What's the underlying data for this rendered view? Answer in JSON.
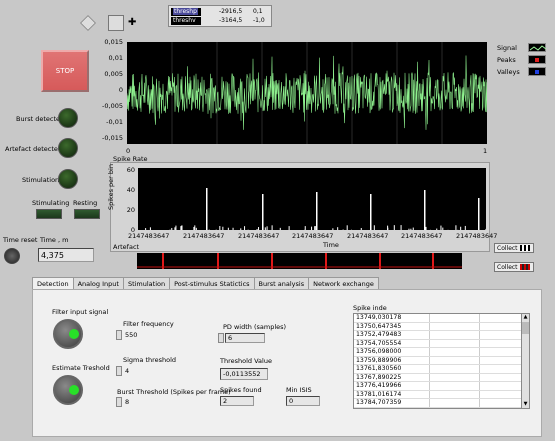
{
  "legend_top": {
    "rows": [
      {
        "name": "threshp",
        "v1": "-2916,5",
        "v2": "0,1"
      },
      {
        "name": "threshv",
        "v1": "-3164,5",
        "v2": "-1,0"
      }
    ]
  },
  "stop_label": "STOP",
  "indicators": {
    "burst": "Burst detected",
    "artefact": "Artefact detected",
    "stimulation": "Stimulation",
    "stimulating": "Stimulating",
    "resting": "Resting"
  },
  "time_reset_label": "Time reset",
  "time_label": "Time , m",
  "time_value": "4,375",
  "signal_plot": {
    "yticks": [
      "0,015",
      "0,01",
      "0,005",
      "0",
      "-0,005",
      "-0,01",
      "-0,015"
    ],
    "xticks": [
      "0",
      "1"
    ],
    "legend": [
      "Signal",
      "Peaks",
      "Valleys"
    ]
  },
  "spike_rate": {
    "title": "Spike Rate",
    "ylabel": "Spikes per bin",
    "yticks": [
      "60",
      "40",
      "20",
      "0"
    ],
    "xticks": [
      "2147483647",
      "2147483647",
      "2147483647",
      "2147483647",
      "2147483647",
      "2147483647",
      "2147483647"
    ],
    "xlabel": "Time"
  },
  "artefact_label": "Artefact",
  "collect1": "Collect",
  "collect2": "Collect",
  "tabs": [
    "Detection",
    "Analog Input",
    "Stimulation",
    "Post-stimulus Statictics",
    "Burst analysis",
    "Network exchange"
  ],
  "detection": {
    "filter_input_label": "Filter input signal",
    "filter_freq_label": "Filter frequency",
    "filter_freq_value": "550",
    "estimate_label": "Estimate Treshold",
    "sigma_label": "Sigma threshold",
    "sigma_value": "4",
    "burst_thr_label": "Burst Threshold (Spikes per frame)",
    "burst_thr_value": "8",
    "pd_label": "PD width (samples)",
    "pd_value": "6",
    "thr_label": "Threshold  Value",
    "thr_value": "-0,0113552",
    "spikes_label": "Spikes found",
    "spikes_value": "2",
    "minisis_label": "Min ISIS",
    "minisis_value": "0",
    "spike_list_label": "Spike inde",
    "spike_list": [
      "13749,030178",
      "13750,647345",
      "13752,479483",
      "13754,705554",
      "13756,098000",
      "13759,889906",
      "13761,830560",
      "13767,890225",
      "13776,419966",
      "13781,016174",
      "13784,707359"
    ]
  }
}
